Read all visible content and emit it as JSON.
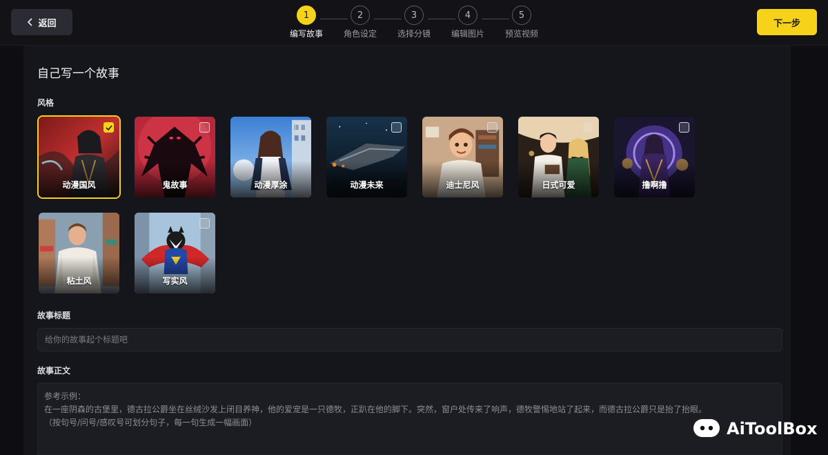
{
  "header": {
    "back_label": "返回",
    "next_label": "下一步",
    "steps": [
      {
        "number": "1",
        "label": "编写故事",
        "active": true
      },
      {
        "number": "2",
        "label": "角色设定",
        "active": false
      },
      {
        "number": "3",
        "label": "选择分镜",
        "active": false
      },
      {
        "number": "4",
        "label": "编辑图片",
        "active": false
      },
      {
        "number": "5",
        "label": "预览视频",
        "active": false
      }
    ]
  },
  "colors": {
    "accent": "#f7d21a",
    "background": "#0e0e12",
    "panel": "#15161b"
  },
  "main": {
    "title": "自己写一个故事",
    "style_section_label": "风格",
    "styles": [
      {
        "name": "动漫国风",
        "selected": true
      },
      {
        "name": "鬼故事",
        "selected": false
      },
      {
        "name": "动漫厚涂",
        "selected": false
      },
      {
        "name": "动漫未来",
        "selected": false
      },
      {
        "name": "迪士尼风",
        "selected": false
      },
      {
        "name": "日式可爱",
        "selected": false
      },
      {
        "name": "撸啊撸",
        "selected": false
      },
      {
        "name": "粘土风",
        "selected": false
      },
      {
        "name": "写实风",
        "selected": false
      }
    ],
    "story_title_label": "故事标题",
    "story_title_placeholder": "给你的故事起个标题吧",
    "story_title_value": "",
    "story_body_label": "故事正文",
    "story_body_placeholder": {
      "line1": "参考示例：",
      "line2": "在一座阴森的古堡里，德古拉公爵坐在丝绒沙发上闭目养神，他的爱宠是一只德牧，正趴在他的脚下。突然，窗户处传来了响声，德牧警惕地站了起来，而德古拉公爵只是抬了抬眼。",
      "line3": "（按句号/问号/感叹号可划分句子，每一句生成一幅画面）"
    }
  },
  "watermark": {
    "text": "AiToolBox",
    "icon": "chat-bubble-logo-icon"
  }
}
